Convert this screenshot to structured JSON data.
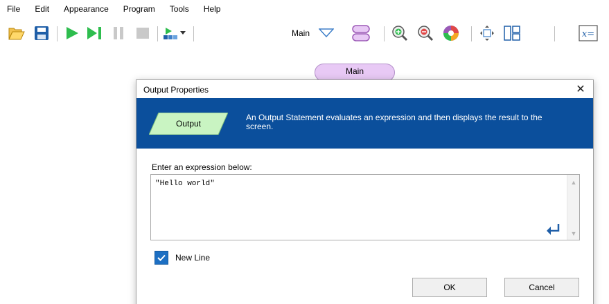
{
  "menu": [
    "File",
    "Edit",
    "Appearance",
    "Program",
    "Tools",
    "Help"
  ],
  "toolbar": {
    "subchart_label": "Main",
    "icons": [
      "open-folder-icon",
      "save-icon",
      "run-icon",
      "step-icon",
      "pause-icon",
      "stop-icon",
      "speed-icon",
      "dropdown-icon",
      "subchart-dropdown-icon",
      "layout-icon",
      "zoom-in-icon",
      "zoom-out-icon",
      "color-wheel-icon",
      "expand-icon",
      "variables-panel-icon",
      "expression-icon"
    ],
    "expression_icon_text": "x="
  },
  "flowchart": {
    "tab_label": "Main"
  },
  "dialog": {
    "title": "Output Properties",
    "close_glyph": "✕",
    "banner": {
      "shape_label": "Output",
      "description": "An Output Statement evaluates an expression and then displays the result to the screen.",
      "background": "#0b4f9c",
      "shape_color": "#c9f4c2"
    },
    "prompt": "Enter an expression below:",
    "expression_value": "\"Hello world\"",
    "new_line_label": "New Line",
    "new_line_checked": true,
    "ok_label": "OK",
    "cancel_label": "Cancel"
  }
}
